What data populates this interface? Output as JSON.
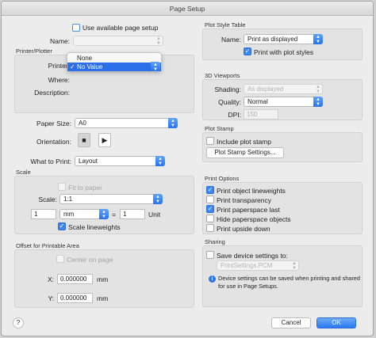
{
  "window": {
    "title": "Page Setup"
  },
  "layout_section": {
    "use_available_page_setup": "Use available page setup",
    "name_label": "Name:",
    "name_value": ""
  },
  "printer_plotter": {
    "title": "Printer/Plotter",
    "printer_label": "Printer:",
    "where_label": "Where:",
    "description_label": "Description:",
    "dropdown_options": [
      "None",
      "No Value"
    ],
    "selected_option": "No Value"
  },
  "paper": {
    "paper_size_label": "Paper Size:",
    "paper_size_value": "A0",
    "orientation_label": "Orientation:",
    "what_to_print_label": "What to Print:",
    "what_to_print_value": "Layout"
  },
  "scale": {
    "title": "Scale",
    "fit_to_paper": "Fit to paper",
    "scale_label": "Scale:",
    "scale_value": "1:1",
    "left_value": "1",
    "unit_value": "mm",
    "equals": "=",
    "right_value": "1",
    "unit_label": "Unit",
    "scale_lineweights": "Scale lineweights"
  },
  "offset": {
    "title": "Offset for Printable Area",
    "center_on_page": "Center on page",
    "x_label": "X:",
    "x_value": "0.000000",
    "x_unit": "mm",
    "y_label": "Y:",
    "y_value": "0.000000",
    "y_unit": "mm"
  },
  "plot_style_table": {
    "title": "Plot Style Table",
    "name_label": "Name:",
    "name_value": "Print as displayed",
    "print_with_plot_styles": "Print with plot styles"
  },
  "viewports_3d": {
    "title": "3D Viewports",
    "shading_label": "Shading:",
    "shading_value": "As displayed",
    "quality_label": "Quality:",
    "quality_value": "Normal",
    "dpi_label": "DPI:",
    "dpi_value": "150"
  },
  "plot_stamp": {
    "title": "Plot Stamp",
    "include_plot_stamp": "Include plot stamp",
    "settings_button": "Plot Stamp Settings..."
  },
  "print_options": {
    "title": "Print Options",
    "items": [
      {
        "label": "Print object lineweights",
        "checked": true
      },
      {
        "label": "Print transparency",
        "checked": false
      },
      {
        "label": "Print paperspace last",
        "checked": true
      },
      {
        "label": "Hide paperspace objects",
        "checked": false
      },
      {
        "label": "Print upside down",
        "checked": false
      }
    ]
  },
  "sharing": {
    "title": "Sharing",
    "save_device_settings": "Save device settings to:",
    "file_value": "PrintSettings.PCM",
    "info_text_line1": "Device settings can be saved when printing and shared",
    "info_text_line2": "for use in Page Setups."
  },
  "footer": {
    "help": "?",
    "cancel": "Cancel",
    "ok": "OK"
  },
  "colors": {
    "accent": "#2b78f0",
    "selection": "#2d6fe8"
  },
  "icons": [
    "help-icon",
    "portrait-icon",
    "landscape-icon",
    "info-icon",
    "chevron-updown-icon",
    "stepper-icon"
  ]
}
